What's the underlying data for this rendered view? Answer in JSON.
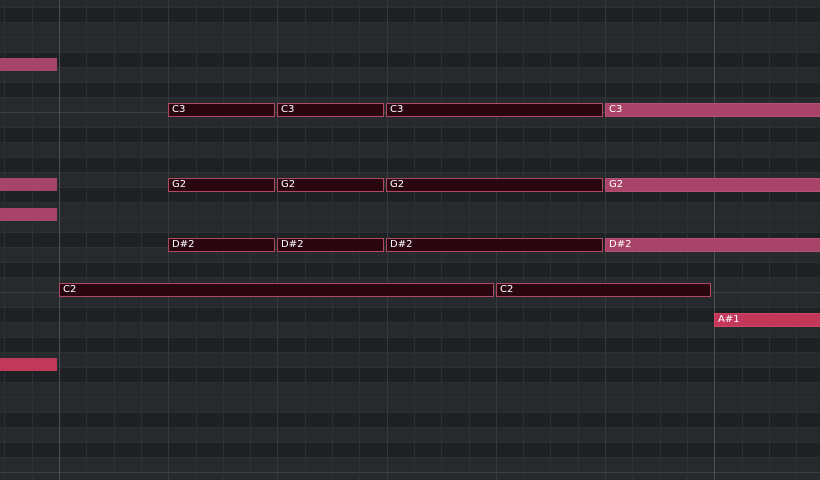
{
  "piano_roll": {
    "notes": [
      {
        "label": "C3",
        "state": "selected"
      },
      {
        "label": "C3",
        "state": "selected"
      },
      {
        "label": "C3",
        "state": "selected"
      },
      {
        "label": "C3",
        "state": "unselected"
      },
      {
        "label": "G2",
        "state": "selected"
      },
      {
        "label": "G2",
        "state": "selected"
      },
      {
        "label": "G2",
        "state": "selected"
      },
      {
        "label": "G2",
        "state": "unselected"
      },
      {
        "label": "D#2",
        "state": "selected"
      },
      {
        "label": "D#2",
        "state": "selected"
      },
      {
        "label": "D#2",
        "state": "selected"
      },
      {
        "label": "D#2",
        "state": "unselected"
      },
      {
        "label": "C2",
        "state": "selected"
      },
      {
        "label": "C2",
        "state": "selected"
      },
      {
        "label": "A#1",
        "state": "unselected"
      }
    ]
  },
  "colors": {
    "background": "#232629",
    "note_selected_fill": "#2a0710",
    "note_selected_border": "#b04a62",
    "note_fill": "#a84468",
    "note_bright_fill": "#c3385a",
    "bar_line": "#4a5055"
  }
}
